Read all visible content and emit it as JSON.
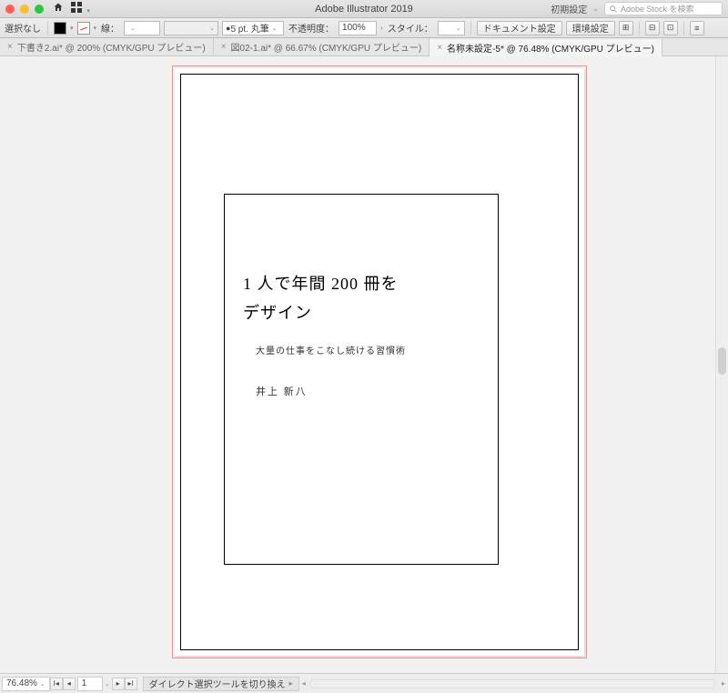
{
  "titlebar": {
    "app_title": "Adobe Illustrator 2019",
    "workspace_label": "初期設定",
    "search_placeholder": "Adobe Stock を検索"
  },
  "controlbar": {
    "selection_label": "選択なし",
    "stroke_label": "線：",
    "stroke_weight": "",
    "brush_size": "5 pt. 丸筆",
    "opacity_label": "不透明度：",
    "opacity_value": "100%",
    "style_label": "スタイル：",
    "doc_setup": "ドキュメント設定",
    "env_setup": "環境設定"
  },
  "tabs": [
    {
      "label": "下書き2.ai* @ 200% (CMYK/GPU プレビュー)",
      "active": false
    },
    {
      "label": "図02-1.ai* @ 66.67% (CMYK/GPU プレビュー)",
      "active": false
    },
    {
      "label": "名称未設定-5* @ 76.48% (CMYK/GPU プレビュー)",
      "active": true
    }
  ],
  "artwork": {
    "title_line1": "1 人で年間 200 冊を",
    "title_line2": "デザイン",
    "subtitle": "大量の仕事をこなし続ける習慣術",
    "author": "井上 新八"
  },
  "statusbar": {
    "zoom": "76.48%",
    "page": "1",
    "tool_hint": "ダイレクト選択ツールを切り換え"
  }
}
